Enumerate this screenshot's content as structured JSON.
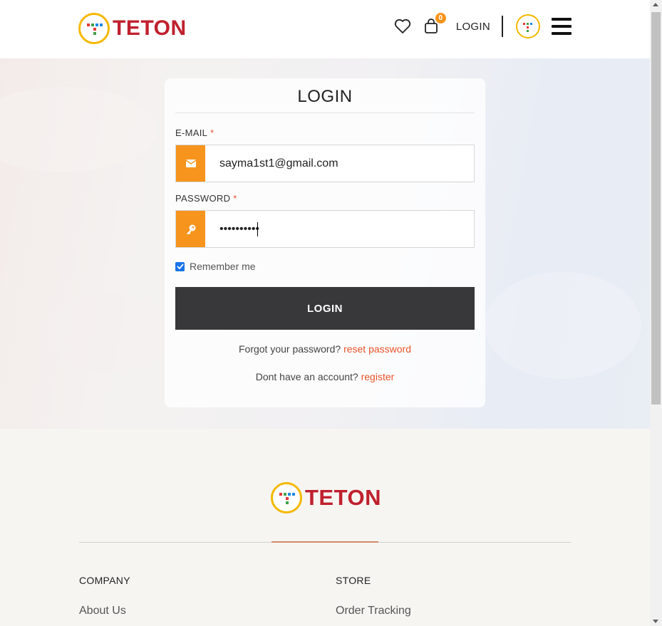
{
  "header": {
    "logo_text": "TETON",
    "cart_count": "0",
    "login_label": "LOGIN",
    "icons": {
      "wishlist": "heart-icon",
      "cart": "shopping-bag-icon",
      "avatar": "teton-avatar-icon",
      "menu": "hamburger-menu-icon"
    }
  },
  "login_form": {
    "title": "LOGIN",
    "email_label": "E-MAIL",
    "email_value": "sayma1st1@gmail.com",
    "password_label": "PASSWORD",
    "password_value": "••••••••••",
    "required_mark": "*",
    "remember_label": "Remember me",
    "remember_checked": true,
    "submit_label": "LOGIN",
    "forgot_text": "Forgot your password?",
    "reset_link": "reset password",
    "no_account_text": "Dont have an account?",
    "register_link": "register"
  },
  "footer": {
    "logo_text": "TETON",
    "columns": [
      {
        "heading": "COMPANY",
        "first_link": "About Us"
      },
      {
        "heading": "STORE",
        "first_link": "Order Tracking"
      }
    ]
  },
  "colors": {
    "brand_red": "#c0202e",
    "accent_orange": "#f7941d",
    "link_orange": "#e8532b",
    "button_dark": "#38383a",
    "logo_ring": "#f5b800"
  }
}
